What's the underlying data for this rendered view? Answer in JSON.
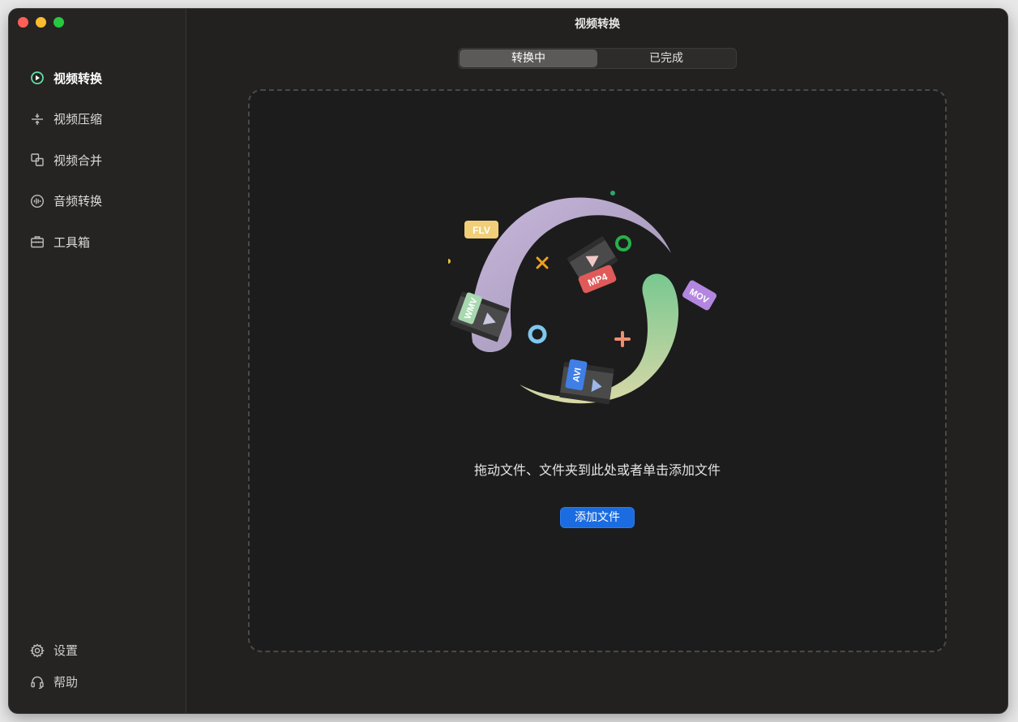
{
  "window": {
    "title": "视频转换"
  },
  "sidebar": {
    "items": [
      {
        "label": "视频转换",
        "icon": "play-circle-icon",
        "active": true
      },
      {
        "label": "视频压缩",
        "icon": "compress-icon",
        "active": false
      },
      {
        "label": "视频合并",
        "icon": "merge-icon",
        "active": false
      },
      {
        "label": "音频转换",
        "icon": "audio-wave-icon",
        "active": false
      },
      {
        "label": "工具箱",
        "icon": "toolbox-icon",
        "active": false
      }
    ],
    "bottom": [
      {
        "label": "设置",
        "icon": "gear-icon"
      },
      {
        "label": "帮助",
        "icon": "headset-icon"
      }
    ]
  },
  "tabs": [
    {
      "label": "转换中",
      "active": true
    },
    {
      "label": "已完成",
      "active": false
    }
  ],
  "dropzone": {
    "hint": "拖动文件、文件夹到此处或者单击添加文件",
    "button_label": "添加文件"
  },
  "illustration": {
    "badges": [
      "FLV",
      "MP4",
      "MOV",
      "AVI",
      "WMV"
    ]
  },
  "colors": {
    "accent": "#1a6ce0",
    "active_icon": "#5ee0a0",
    "background": "#222120"
  }
}
